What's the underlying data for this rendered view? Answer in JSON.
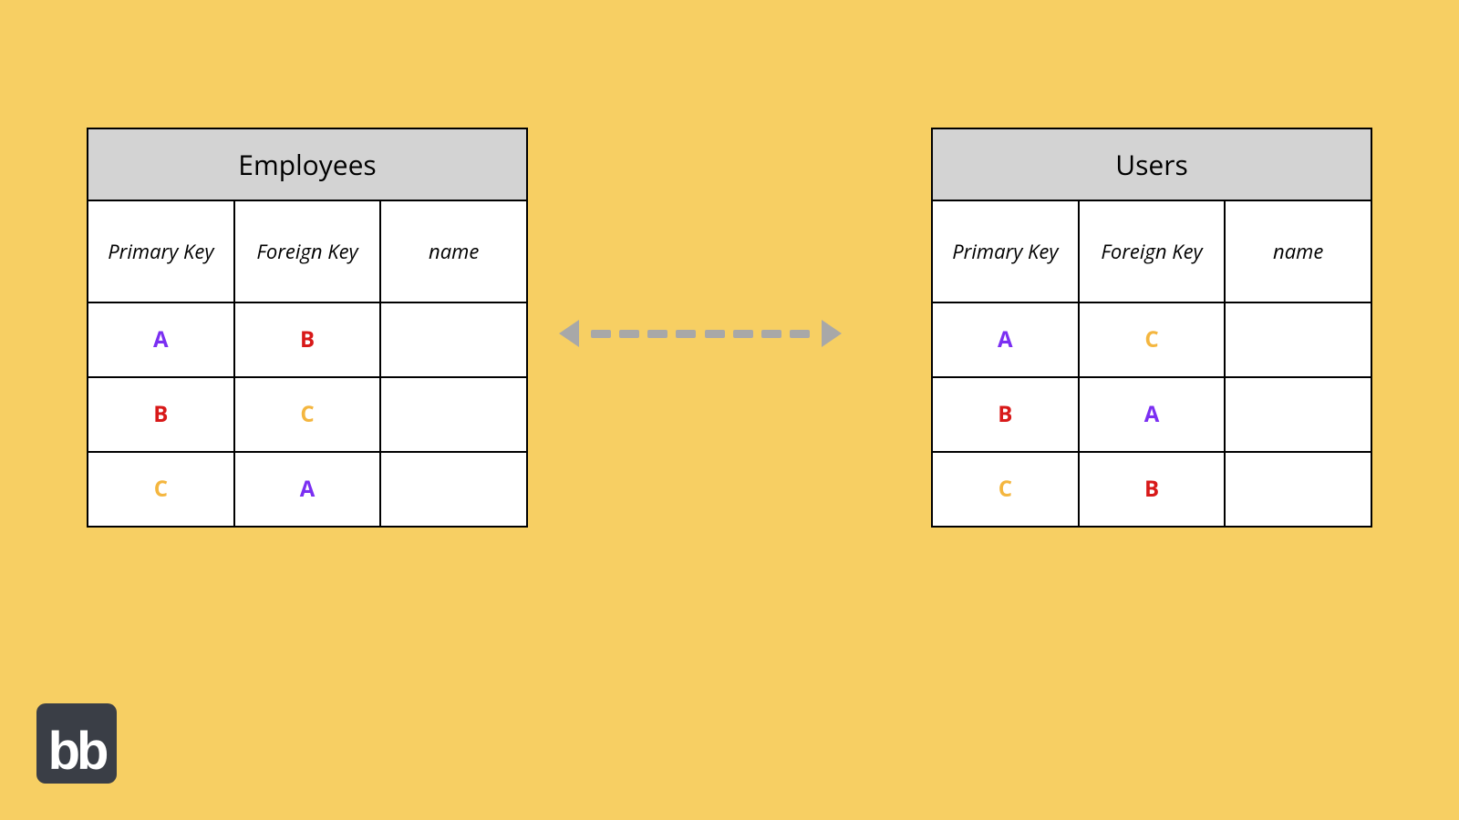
{
  "logo": {
    "text": "bb"
  },
  "tables": {
    "left": {
      "title": "Employees",
      "columns": [
        "Primary Key",
        "Foreign Key",
        "name"
      ],
      "rows": [
        {
          "pk": {
            "v": "A",
            "c": "purple"
          },
          "fk": {
            "v": "B",
            "c": "red"
          },
          "name": ""
        },
        {
          "pk": {
            "v": "B",
            "c": "red"
          },
          "fk": {
            "v": "C",
            "c": "gold"
          },
          "name": ""
        },
        {
          "pk": {
            "v": "C",
            "c": "gold"
          },
          "fk": {
            "v": "A",
            "c": "purple"
          },
          "name": ""
        }
      ]
    },
    "right": {
      "title": "Users",
      "columns": [
        "Primary Key",
        "Foreign Key",
        "name"
      ],
      "rows": [
        {
          "pk": {
            "v": "A",
            "c": "purple"
          },
          "fk": {
            "v": "C",
            "c": "gold"
          },
          "name": ""
        },
        {
          "pk": {
            "v": "B",
            "c": "red"
          },
          "fk": {
            "v": "A",
            "c": "purple"
          },
          "name": ""
        },
        {
          "pk": {
            "v": "C",
            "c": "gold"
          },
          "fk": {
            "v": "B",
            "c": "red"
          },
          "name": ""
        }
      ]
    }
  },
  "colors": {
    "purple": "#7b2ff2",
    "red": "#d81919",
    "gold": "#f4b63f",
    "bg": "#f7cf63",
    "arrow": "#a8a8a8"
  }
}
